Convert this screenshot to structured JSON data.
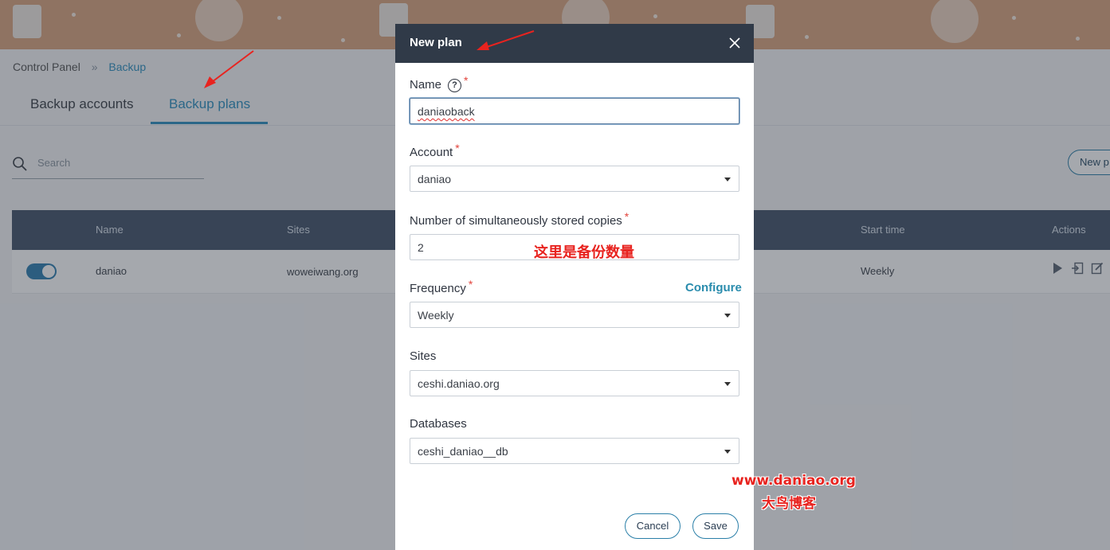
{
  "breadcrumb": {
    "root": "Control Panel",
    "separator": "»",
    "current": "Backup"
  },
  "tabs": [
    {
      "label": "Backup accounts",
      "active": false
    },
    {
      "label": "Backup plans",
      "active": true
    }
  ],
  "search": {
    "placeholder": "Search",
    "icon": "search-icon"
  },
  "toolbar": {
    "new_plan_label": "New p"
  },
  "table": {
    "columns": [
      "Name",
      "Sites",
      "Start time",
      "Actions"
    ],
    "rows": [
      {
        "enabled": true,
        "name": "daniao",
        "sites": "woweiwang.org",
        "start_time": "Weekly",
        "actions": [
          "play-icon",
          "restore-icon",
          "edit-icon"
        ]
      }
    ]
  },
  "modal": {
    "title": "New plan",
    "close_icon": "close-icon",
    "name": {
      "label": "Name",
      "required_mark": "*",
      "help_icon": "?",
      "value": "daniaoback"
    },
    "account": {
      "label": "Account",
      "required_mark": "*",
      "value": "daniao"
    },
    "copies": {
      "label": "Number of simultaneously stored copies",
      "required_mark": "*",
      "value": "2"
    },
    "frequency": {
      "label": "Frequency",
      "required_mark": "*",
      "configure_label": "Configure",
      "value": "Weekly"
    },
    "sites": {
      "label": "Sites",
      "value": "ceshi.daniao.org"
    },
    "databases": {
      "label": "Databases",
      "value": "ceshi_daniao__db"
    },
    "cancel_label": "Cancel",
    "save_label": "Save"
  },
  "annotations": {
    "copies_note": "这里是备份数量",
    "watermark_url": "www.daniao.org",
    "watermark_name": "大鸟博客",
    "accent_color": "#e8231f"
  },
  "colors": {
    "primary": "#2d8fbf",
    "header_dark": "#303a48",
    "table_header": "#44546a"
  }
}
